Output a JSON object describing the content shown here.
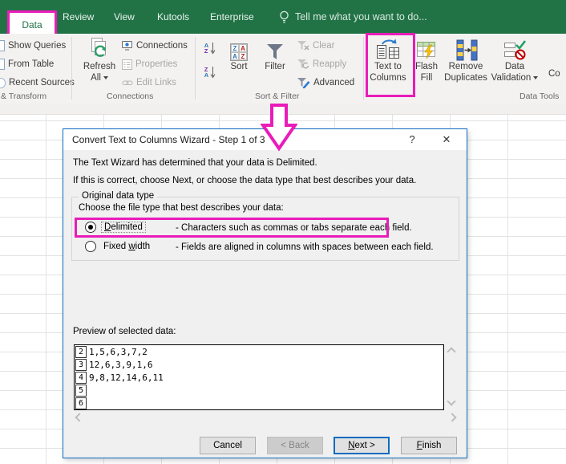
{
  "ribbon": {
    "tabs": [
      {
        "label": "Data",
        "active": true
      },
      {
        "label": "Review"
      },
      {
        "label": "View"
      },
      {
        "label": "Kutools"
      },
      {
        "label": "Enterprise"
      }
    ],
    "tellme": "Tell me what you want to do...",
    "get_transform": {
      "items": [
        "Show Queries",
        "From Table",
        "Recent Sources"
      ],
      "label": "& Transform"
    },
    "connections": {
      "refresh1": "Refresh",
      "refresh2": "All",
      "items": [
        "Connections",
        "Properties",
        "Edit Links"
      ],
      "label": "Connections"
    },
    "sort_filter": {
      "sort": "Sort",
      "filter": "Filter",
      "clear": "Clear",
      "reapply": "Reapply",
      "advanced": "Advanced",
      "label": "Sort & Filter"
    },
    "data_tools": {
      "ttc1": "Text to",
      "ttc2": "Columns",
      "flash1": "Flash",
      "flash2": "Fill",
      "dup1": "Remove",
      "dup2": "Duplicates",
      "val1": "Data",
      "val2": "Validation",
      "overflow": "Co",
      "label": "Data Tools"
    }
  },
  "dialog": {
    "title": "Convert Text to Columns Wizard - Step 1 of 3",
    "help": "?",
    "close": "✕",
    "intro1": "The Text Wizard has determined that your data is Delimited.",
    "intro2": "If this is correct, choose Next, or choose the data type that best describes your data.",
    "group_label": "Original data type",
    "choose_label": "Choose the file type that best describes your data:",
    "delimited": {
      "u": "D",
      "post": "elimited",
      "desc": "- Characters such as commas or tabs separate each field."
    },
    "fixed": {
      "pre": "Fixed ",
      "u": "w",
      "post": "idth",
      "desc": "- Fields are aligned in columns with spaces between each field."
    },
    "preview_label": "Preview of selected data:",
    "preview_rows": [
      {
        "num": "2",
        "text": "1,5,6,3,7,2"
      },
      {
        "num": "3",
        "text": "12,6,3,9,1,6"
      },
      {
        "num": "4",
        "text": "9,8,12,14,6,11"
      },
      {
        "num": "5",
        "text": ""
      },
      {
        "num": "6",
        "text": ""
      }
    ],
    "buttons": {
      "cancel": "Cancel",
      "back": "< Back",
      "next": {
        "u": "N",
        "post": "ext >"
      },
      "finish": {
        "u": "F",
        "post": "inish"
      }
    }
  },
  "colors": {
    "excel_green": "#217346",
    "highlight_magenta": "#e91cb9",
    "dialog_border_blue": "#0f6cc0"
  }
}
